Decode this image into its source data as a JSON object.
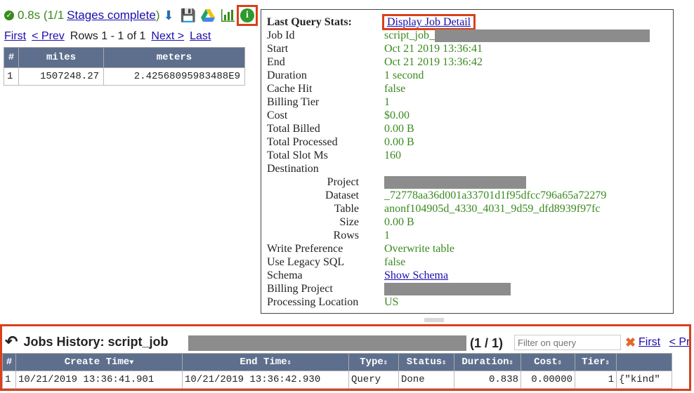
{
  "status": {
    "time": "0.8s",
    "stages": "(1/1",
    "stages_link": "Stages complete",
    ")": ")"
  },
  "pager": {
    "first": "First",
    "prev": "< Prev",
    "rows": "Rows 1 - 1 of 1",
    "next": "Next >",
    "last": "Last"
  },
  "results": {
    "headers": [
      "#",
      "miles",
      "meters"
    ],
    "rows": [
      [
        "1",
        "1507248.27",
        "2.42568095983488E9"
      ]
    ]
  },
  "stats": {
    "title": "Last Query Stats:",
    "detail_link": "Display Job Detail",
    "job_id_label": "Job Id",
    "job_id": "script_job_",
    "start_label": "Start",
    "start": "Oct 21 2019 13:36:41",
    "end_label": "End",
    "end": "Oct 21 2019 13:36:42",
    "duration_label": "Duration",
    "duration": "1 second",
    "cache_label": "Cache Hit",
    "cache": "false",
    "tier_label": "Billing Tier",
    "tier": "1",
    "cost_label": "Cost",
    "cost": "$0.00",
    "billed_label": "Total Billed",
    "billed": "0.00  B",
    "processed_label": "Total Processed",
    "processed": "0.00  B",
    "slot_label": "Total Slot Ms",
    "slot": "160",
    "dest_label": "Destination",
    "project_label": "Project",
    "dataset_label": "Dataset",
    "dataset": "_72778aa36d001a33701d1f95dfcc796a65a72279",
    "table_label": "Table",
    "table": "anonf104905d_4330_4031_9d59_dfd8939f97fc",
    "size_label": "Size",
    "size": "0.00  B",
    "rows_label": "Rows",
    "rows": "1",
    "write_label": "Write Preference",
    "write": "Overwrite table",
    "legacy_label": "Use Legacy SQL",
    "legacy": "false",
    "schema_label": "Schema",
    "schema_link": "Show Schema",
    "billproj_label": "Billing Project",
    "loc_label": "Processing Location",
    "loc": "US"
  },
  "jobs": {
    "title": "Jobs History: script_job",
    "page": "(1 / 1)",
    "filter_placeholder": "Filter on query",
    "first": "First",
    "prev": "< Pre",
    "headers": [
      "#",
      "Create Time",
      "End Time",
      "Type",
      "Status",
      "Duration",
      "Cost",
      "Tier",
      ""
    ],
    "rows": [
      [
        "1",
        "10/21/2019 13:36:41.901",
        "10/21/2019 13:36:42.930",
        "Query",
        "Done",
        "0.838",
        "0.00000",
        "1",
        "{\"kind\""
      ]
    ]
  },
  "colors": {
    "accent": "#d9401b",
    "ok": "#3a8a1f",
    "header": "#5d6f8c",
    "link": "#1a0dab"
  },
  "icons": [
    "check-circle-icon",
    "download-icon",
    "save-icon",
    "drive-icon",
    "chart-icon",
    "info-icon",
    "undo-icon",
    "clear-icon"
  ]
}
